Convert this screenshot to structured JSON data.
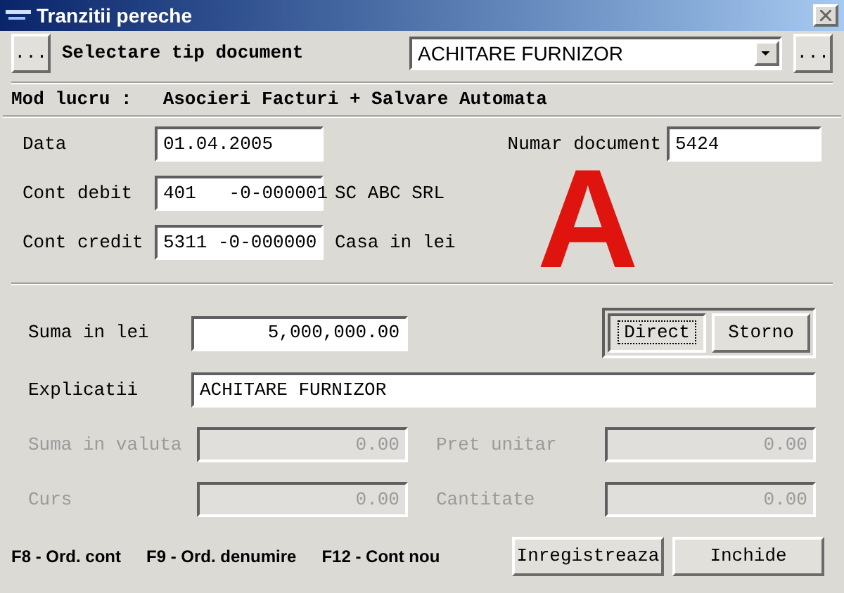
{
  "window": {
    "title": "Tranzitii pereche"
  },
  "doc_type": {
    "left_button": "...",
    "label": "Selectare tip document",
    "value": "ACHITARE FURNIZOR",
    "right_button": "..."
  },
  "mode": {
    "label": "Mod lucru :",
    "value": "Asocieri Facturi + Salvare Automata"
  },
  "header_fields": [
    {
      "label": "Data",
      "value": "01.04.2005"
    },
    {
      "label": "Cont debit",
      "value": "401   -0-000001",
      "name": "SC ABC SRL"
    },
    {
      "label": "Cont credit",
      "value": "5311 -0-000000",
      "name": "Casa in lei"
    }
  ],
  "document_number": {
    "label": "Numar document",
    "value": "5424"
  },
  "marker": "A",
  "amount": {
    "label": "Suma in lei",
    "value": "5,000,000.00"
  },
  "direction": [
    {
      "label": "Direct",
      "selected": true
    },
    {
      "label": "Storno",
      "selected": false
    }
  ],
  "explanation": {
    "label": "Explicatii",
    "value": "ACHITARE FURNIZOR"
  },
  "currency_fields": [
    {
      "label": "Suma in valuta",
      "value": "0.00",
      "disabled": true
    },
    {
      "label": "Pret unitar",
      "value": "0.00",
      "disabled": true
    },
    {
      "label": "Curs",
      "value": "0.00",
      "disabled": true
    },
    {
      "label": "Cantitate",
      "value": "0.00",
      "disabled": true
    }
  ],
  "shortcuts": [
    "F8 - Ord. cont",
    "F9 - Ord. denumire",
    "F12 - Cont nou"
  ],
  "buttons": [
    "Inregistreaza",
    "Inchide"
  ]
}
